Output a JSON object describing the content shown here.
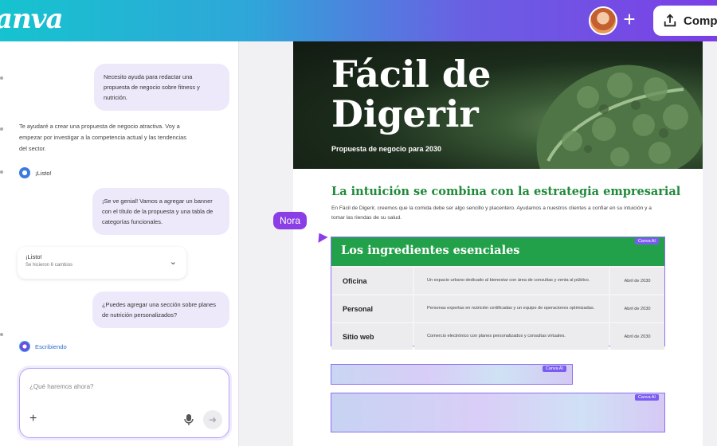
{
  "app": {
    "logo": "anva",
    "share_label": "Compa",
    "add_label": "+"
  },
  "chat": {
    "user_msg_1": "Necesito ayuda para redactar una propuesta de negocio sobre fitness y nutrición.",
    "ai_msg_1": "Te ayudaré a crear una propuesta de negocio atractiva. Voy a empezar por investigar a la competencia actual y las tendencias del sector.",
    "status_done": "¡Listo!",
    "user_msg_2": "¡Se ve genial! Vamos a agregar un banner con el título de la propuesta y una tabla de categorías funcionales.",
    "card_title": "¡Listo!",
    "card_sub": "Se hicieron 6 cambios",
    "user_msg_3": "¿Puedes agregar una sección sobre planes de nutrición personalizados?",
    "status_writing": "Escribiendo",
    "input_placeholder": "¿Qué haremos ahora?"
  },
  "doc": {
    "title": "Fácil de Digerir",
    "subtitle": "Propuesta de negocio para 2030",
    "heading": "La intuición se combina con la estrategia empresarial",
    "intro": "En Fácil de Digerir, creemos que la comida debe ser algo sencillo y placentero. Ayudamos a nuestros clientes a confiar en su intuición y a tomar las riendas de su salud.",
    "collaborator": "Nora",
    "tag_label": "Canva AI",
    "table": {
      "title": "Los ingredientes esenciales",
      "rows": [
        {
          "name": "Oficina",
          "desc": "Un espacio urbano dedicado al bienestar con área de consultas y venta al público.",
          "date": "Abril de 2030"
        },
        {
          "name": "Personal",
          "desc": "Personas expertas en nutrición certificadas y un equipo de operaciones optimizadas.",
          "date": "Abril de 2030"
        },
        {
          "name": "Sitio web",
          "desc": "Comercio electrónico con planes personalizados y consultas virtuales.",
          "date": "Abril de 2030"
        }
      ]
    }
  }
}
